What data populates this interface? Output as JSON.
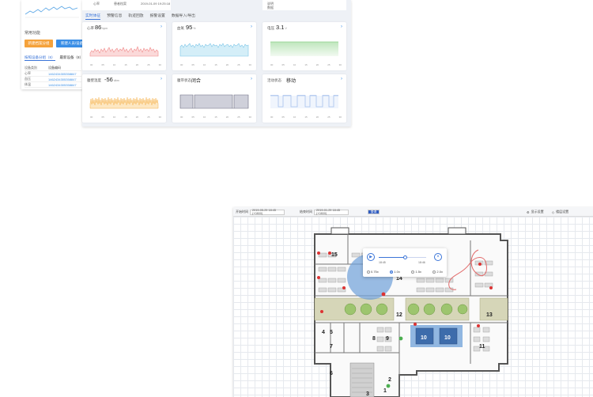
{
  "left_panel": {
    "section_title": "常用功能",
    "btn_primary": "新建档案分组",
    "btn_secondary": "新建人员/设备",
    "tabs": [
      "按照设备分组（8）",
      "最新设备（8）"
    ],
    "table_header": [
      "设备类别",
      "设备编码"
    ],
    "rows": [
      [
        "心率",
        "1462434305358847"
      ],
      [
        "血压",
        "1462434305358847"
      ],
      [
        "体温",
        "1462434305358847"
      ]
    ]
  },
  "dashboard": {
    "tabs": [
      "实时体征",
      "预警信息",
      "轨迹回放",
      "报警设置",
      "数据导入/导出"
    ],
    "active_tab": "实时体征",
    "top_cards": [
      "心率",
      "患者档案",
      "2019-01-09 19:25:18",
      "说明",
      "数据"
    ],
    "cards": [
      {
        "label": "心率",
        "value": "86",
        "unit": "bpm",
        "ticks": [
          "00",
          "05",
          "10",
          "15",
          "20",
          "25",
          "30"
        ]
      },
      {
        "label": "血氧",
        "value": "95",
        "unit": "%",
        "ticks": [
          "00",
          "05",
          "10",
          "15",
          "20",
          "25",
          "30"
        ]
      },
      {
        "label": "电压",
        "value": "3.1",
        "unit": "V",
        "ticks": [
          "00",
          "05",
          "10",
          "15",
          "20",
          "25",
          "30"
        ]
      },
      {
        "label": "腹壁温度",
        "value": "-56",
        "unit": "dbm",
        "ticks": [
          "00",
          "05",
          "10",
          "15",
          "20",
          "25",
          "30"
        ]
      },
      {
        "label": "腹带状态",
        "value": "闭合",
        "unit": "",
        "ticks": [
          "00",
          "05",
          "10",
          "15",
          "20",
          "25",
          "30"
        ]
      },
      {
        "label": "活动状态",
        "value": "移动",
        "unit": "",
        "ticks": [
          "00",
          "05",
          "10",
          "15",
          "20",
          "25",
          "30"
        ]
      }
    ],
    "colors": {
      "hr": "#f08a8a",
      "spo2": "#7dc6e8",
      "volt": "#8cd08a",
      "temp": "#f5b04a",
      "belt": "#6b6b80",
      "act": "#4a7fd8"
    }
  },
  "floorplan_app": {
    "start_label": "开始时间",
    "start_value": "2019-05-29 18:45 (+0800)",
    "end_label": "结束时间",
    "end_value": "2019-01-29 18:45 (+0800)",
    "query_btn": "查询",
    "display_settings": "显示设置",
    "floor_settings": "楼层设置",
    "playback": {
      "start_time": "18:45",
      "end_time": "18:46",
      "progress": 0.55,
      "speeds": [
        "0.75x",
        "1.0x",
        "1.5x",
        "2.0x"
      ],
      "selected_speed": "1.0x"
    },
    "room_numbers": [
      "15",
      "14",
      "13",
      "12",
      "11",
      "10",
      "10",
      "9",
      "8",
      "7",
      "6",
      "5",
      "4",
      "3",
      "2",
      "1"
    ]
  }
}
